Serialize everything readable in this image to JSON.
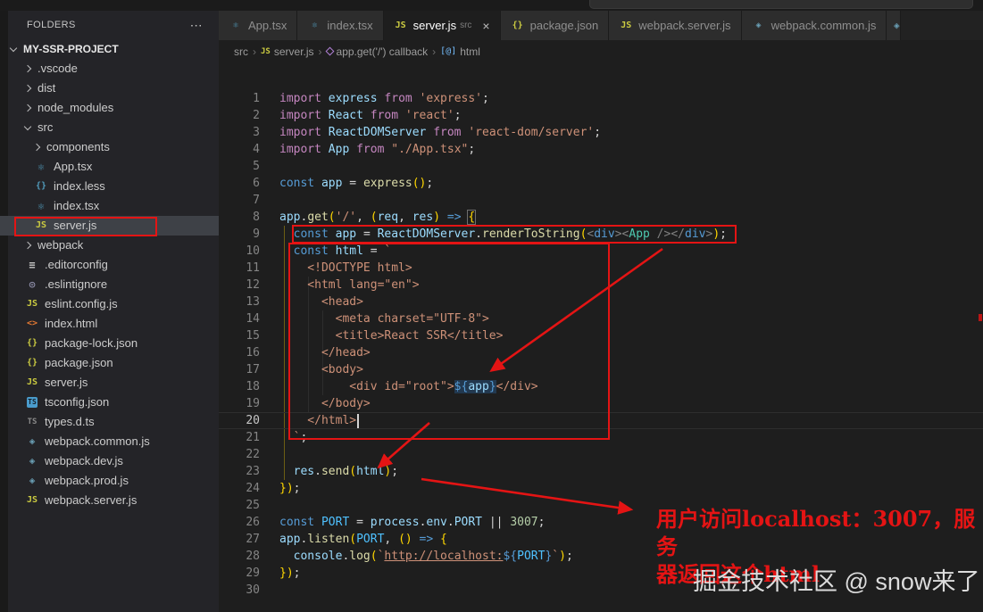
{
  "colors": {
    "red": "#e41414",
    "editor_bg": "#1e1e1e",
    "sidebar_bg": "#242428",
    "titlebar_bg": "#1b1b1b",
    "tab_inactive": "#2d2d2d",
    "tab_active": "#1e1e1e",
    "row_sel": "#3e4147",
    "js_yellow": "#cbcb41",
    "react_blue": "#519aba",
    "string_orange": "#ce9178",
    "keyword_purple": "#c586c0"
  },
  "sidebar": {
    "title": "FOLDERS",
    "more_icon": "⋯",
    "root": "MY-SSR-PROJECT",
    "items": [
      {
        "label": ".vscode",
        "type": "folder",
        "indent": 1
      },
      {
        "label": "dist",
        "type": "folder",
        "indent": 1
      },
      {
        "label": "node_modules",
        "type": "folder",
        "indent": 1
      },
      {
        "label": "src",
        "type": "folder",
        "open": true,
        "indent": 1
      },
      {
        "label": "components",
        "type": "folder",
        "indent": 2
      },
      {
        "label": "App.tsx",
        "icon": "react",
        "indent": 2
      },
      {
        "label": "index.less",
        "icon": "braces-blue",
        "indent": 2
      },
      {
        "label": "index.tsx",
        "icon": "react",
        "indent": 2
      },
      {
        "label": "server.js",
        "icon": "js",
        "indent": 2,
        "selected": true
      },
      {
        "label": "webpack",
        "type": "folder",
        "indent": 1
      },
      {
        "label": ".editorconfig",
        "icon": "editorconfig",
        "indent": 1
      },
      {
        "label": ".eslintignore",
        "icon": "eslint",
        "indent": 1
      },
      {
        "label": "eslint.config.js",
        "icon": "js",
        "indent": 1
      },
      {
        "label": "index.html",
        "icon": "html",
        "indent": 1
      },
      {
        "label": "package-lock.json",
        "icon": "braces",
        "indent": 1
      },
      {
        "label": "package.json",
        "icon": "braces",
        "indent": 1
      },
      {
        "label": "server.js",
        "icon": "js",
        "indent": 1
      },
      {
        "label": "tsconfig.json",
        "icon": "tsconfig",
        "indent": 1
      },
      {
        "label": "types.d.ts",
        "icon": "ts-gray",
        "indent": 1
      },
      {
        "label": "webpack.common.js",
        "icon": "webpack",
        "indent": 1
      },
      {
        "label": "webpack.dev.js",
        "icon": "webpack",
        "indent": 1
      },
      {
        "label": "webpack.prod.js",
        "icon": "webpack",
        "indent": 1
      },
      {
        "label": "webpack.server.js",
        "icon": "js",
        "indent": 1
      }
    ]
  },
  "tabs": [
    {
      "label": "App.tsx",
      "icon": "react"
    },
    {
      "label": "index.tsx",
      "icon": "react"
    },
    {
      "label": "server.js",
      "icon": "js",
      "active": true,
      "badge": "src",
      "close": "×"
    },
    {
      "label": "package.json",
      "icon": "braces"
    },
    {
      "label": "webpack.server.js",
      "icon": "js"
    },
    {
      "label": "webpack.common.js",
      "icon": "webpack"
    }
  ],
  "breadcrumb": [
    {
      "label": "src"
    },
    {
      "label": "server.js",
      "icon": "js"
    },
    {
      "label": "app.get('/') callback",
      "icon": "method"
    },
    {
      "label": "html",
      "icon": "field"
    }
  ],
  "code": {
    "lines": [
      {
        "n": 1,
        "t": [
          [
            "import ",
            "kw"
          ],
          [
            "express ",
            "var"
          ],
          [
            "from ",
            "kw"
          ],
          [
            "'express'",
            "str"
          ],
          [
            ";",
            "pl"
          ]
        ]
      },
      {
        "n": 2,
        "t": [
          [
            "import ",
            "kw"
          ],
          [
            "React ",
            "var"
          ],
          [
            "from ",
            "kw"
          ],
          [
            "'react'",
            "str"
          ],
          [
            ";",
            "pl"
          ]
        ]
      },
      {
        "n": 3,
        "t": [
          [
            "import ",
            "kw"
          ],
          [
            "ReactDOMServer ",
            "var"
          ],
          [
            "from ",
            "kw"
          ],
          [
            "'react-dom/server'",
            "str"
          ],
          [
            ";",
            "pl"
          ]
        ]
      },
      {
        "n": 4,
        "t": [
          [
            "import ",
            "kw"
          ],
          [
            "App ",
            "var"
          ],
          [
            "from ",
            "kw"
          ],
          [
            "\"./App.tsx\"",
            "str"
          ],
          [
            ";",
            "pl"
          ]
        ]
      },
      {
        "n": 5,
        "t": []
      },
      {
        "n": 6,
        "t": [
          [
            "const ",
            "kw2"
          ],
          [
            "app ",
            "var"
          ],
          [
            "= ",
            "pl"
          ],
          [
            "express",
            "fn"
          ],
          [
            "()",
            "brk"
          ],
          [
            ";",
            "pl"
          ]
        ]
      },
      {
        "n": 7,
        "t": []
      },
      {
        "n": 8,
        "t": [
          [
            "app",
            "var"
          ],
          [
            ".",
            "pl"
          ],
          [
            "get",
            "fn"
          ],
          [
            "(",
            "brk"
          ],
          [
            "'/'",
            "str"
          ],
          [
            ", ",
            "pl"
          ],
          [
            "(",
            "brk"
          ],
          [
            "req",
            "var"
          ],
          [
            ", ",
            "pl"
          ],
          [
            "res",
            "var"
          ],
          [
            ")",
            "brk"
          ],
          [
            " => ",
            "kw2"
          ],
          [
            "{",
            "brk match"
          ]
        ]
      },
      {
        "n": 9,
        "t": [
          [
            "  ",
            "pl"
          ],
          [
            "const ",
            "kw2"
          ],
          [
            "app ",
            "var"
          ],
          [
            "= ",
            "pl"
          ],
          [
            "ReactDOMServer",
            "var"
          ],
          [
            ".",
            "pl"
          ],
          [
            "renderToString",
            "fn"
          ],
          [
            "(",
            "brk"
          ],
          [
            "<",
            "jsxp"
          ],
          [
            "div",
            "tag"
          ],
          [
            "><",
            "jsxp"
          ],
          [
            "App",
            "cls"
          ],
          [
            " />",
            "jsxp"
          ],
          [
            "</",
            "jsxp"
          ],
          [
            "div",
            "tag"
          ],
          [
            ">",
            "jsxp"
          ],
          [
            ")",
            "brk"
          ],
          [
            ";",
            "pl"
          ]
        ]
      },
      {
        "n": 10,
        "t": [
          [
            "  ",
            "pl"
          ],
          [
            "const ",
            "kw2"
          ],
          [
            "html ",
            "var"
          ],
          [
            "= ",
            "pl"
          ],
          [
            "`",
            "str"
          ]
        ]
      },
      {
        "n": 11,
        "t": [
          [
            "    <!DOCTYPE html>",
            "str"
          ]
        ]
      },
      {
        "n": 12,
        "t": [
          [
            "    <html lang=\"en\">",
            "str"
          ]
        ]
      },
      {
        "n": 13,
        "t": [
          [
            "      <head>",
            "str"
          ]
        ]
      },
      {
        "n": 14,
        "t": [
          [
            "        <meta charset=\"UTF-8\">",
            "str"
          ]
        ]
      },
      {
        "n": 15,
        "t": [
          [
            "        <title>React SSR</title>",
            "str"
          ]
        ]
      },
      {
        "n": 16,
        "t": [
          [
            "      </head>",
            "str"
          ]
        ]
      },
      {
        "n": 17,
        "t": [
          [
            "      <body>",
            "str"
          ]
        ]
      },
      {
        "n": 18,
        "t": [
          [
            "          <div id=\"root\">",
            "str"
          ],
          [
            "${",
            "tpl hl"
          ],
          [
            "app",
            "var hl"
          ],
          [
            "}",
            "tpl hl"
          ],
          [
            "</div>",
            "str"
          ]
        ]
      },
      {
        "n": 19,
        "t": [
          [
            "      </body>",
            "str"
          ]
        ]
      },
      {
        "n": 20,
        "t": [
          [
            "    </html>",
            "str"
          ]
        ],
        "cursor": true,
        "active": true
      },
      {
        "n": 21,
        "t": [
          [
            "  `",
            "str"
          ],
          [
            ";",
            "pl"
          ]
        ]
      },
      {
        "n": 22,
        "t": []
      },
      {
        "n": 23,
        "t": [
          [
            "  ",
            "pl"
          ],
          [
            "res",
            "var"
          ],
          [
            ".",
            "pl"
          ],
          [
            "send",
            "fn"
          ],
          [
            "(",
            "brk"
          ],
          [
            "html",
            "var"
          ],
          [
            ")",
            "brk"
          ],
          [
            ";",
            "pl"
          ]
        ]
      },
      {
        "n": 24,
        "t": [
          [
            "})",
            "brk"
          ],
          [
            ";",
            "pl"
          ]
        ]
      },
      {
        "n": 25,
        "t": []
      },
      {
        "n": 26,
        "t": [
          [
            "const ",
            "kw2"
          ],
          [
            "PORT ",
            "cnst"
          ],
          [
            "= ",
            "pl"
          ],
          [
            "process",
            "var"
          ],
          [
            ".",
            "pl"
          ],
          [
            "env",
            "var"
          ],
          [
            ".",
            "pl"
          ],
          [
            "PORT",
            "var"
          ],
          [
            " || ",
            "pl"
          ],
          [
            "3007",
            "num"
          ],
          [
            ";",
            "pl"
          ]
        ]
      },
      {
        "n": 27,
        "t": [
          [
            "app",
            "var"
          ],
          [
            ".",
            "pl"
          ],
          [
            "listen",
            "fn"
          ],
          [
            "(",
            "brk"
          ],
          [
            "PORT",
            "cnst"
          ],
          [
            ", ",
            "pl"
          ],
          [
            "()",
            "brk"
          ],
          [
            " => ",
            "kw2"
          ],
          [
            "{",
            "brk"
          ]
        ]
      },
      {
        "n": 28,
        "t": [
          [
            "  ",
            "pl"
          ],
          [
            "console",
            "var"
          ],
          [
            ".",
            "pl"
          ],
          [
            "log",
            "fn"
          ],
          [
            "(",
            "brk"
          ],
          [
            "`",
            "str"
          ],
          [
            "http://localhost:",
            "stru"
          ],
          [
            "${",
            "tpl"
          ],
          [
            "PORT",
            "cnst"
          ],
          [
            "}",
            "tpl"
          ],
          [
            "`",
            "str"
          ],
          [
            ")",
            "brk"
          ],
          [
            ";",
            "pl"
          ]
        ]
      },
      {
        "n": 29,
        "t": [
          [
            "})",
            "brk"
          ],
          [
            ";",
            "pl"
          ]
        ]
      },
      {
        "n": 30,
        "t": []
      }
    ]
  },
  "annotations": {
    "note1": "用户访问localhost：3007，服务",
    "note2": "器返回这个html",
    "watermark": "掘金技术社区 @ snow来了"
  }
}
